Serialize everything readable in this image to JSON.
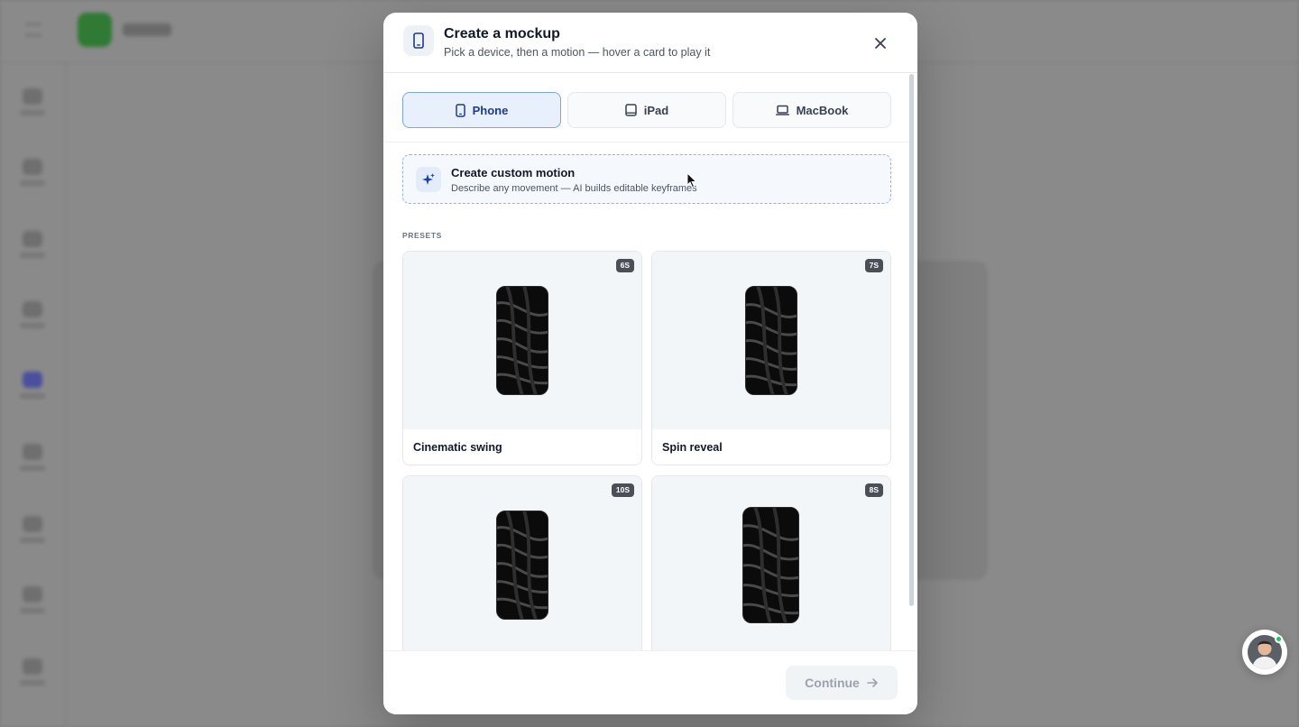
{
  "modal": {
    "title": "Create a mockup",
    "subtitle": "Pick a device, then a motion — hover a card to play it",
    "icon": "phone-icon",
    "close_icon": "close-icon"
  },
  "tabs": [
    {
      "label": "Phone",
      "icon": "phone-icon",
      "active": true
    },
    {
      "label": "iPad",
      "icon": "tablet-icon",
      "active": false
    },
    {
      "label": "MacBook",
      "icon": "laptop-icon",
      "active": false
    }
  ],
  "custom_motion": {
    "title": "Create custom motion",
    "description": "Describe any movement — AI builds editable keyframes",
    "icon": "sparkle-icon"
  },
  "presets": {
    "label": "PRESETS",
    "cards": [
      {
        "name": "Cinematic swing",
        "duration": "6S"
      },
      {
        "name": "Spin reveal",
        "duration": "7S"
      },
      {
        "name": "",
        "duration": "10S"
      },
      {
        "name": "",
        "duration": "8S"
      }
    ]
  },
  "footer": {
    "continue_label": "Continue",
    "continue_icon": "arrow-right-icon"
  },
  "colors": {
    "accent": "#1e3a8a",
    "active_tab_bg": "#e8f1fb",
    "active_tab_border": "#7aa7de",
    "badge_bg": "#4b5058",
    "online": "#22c55e"
  }
}
